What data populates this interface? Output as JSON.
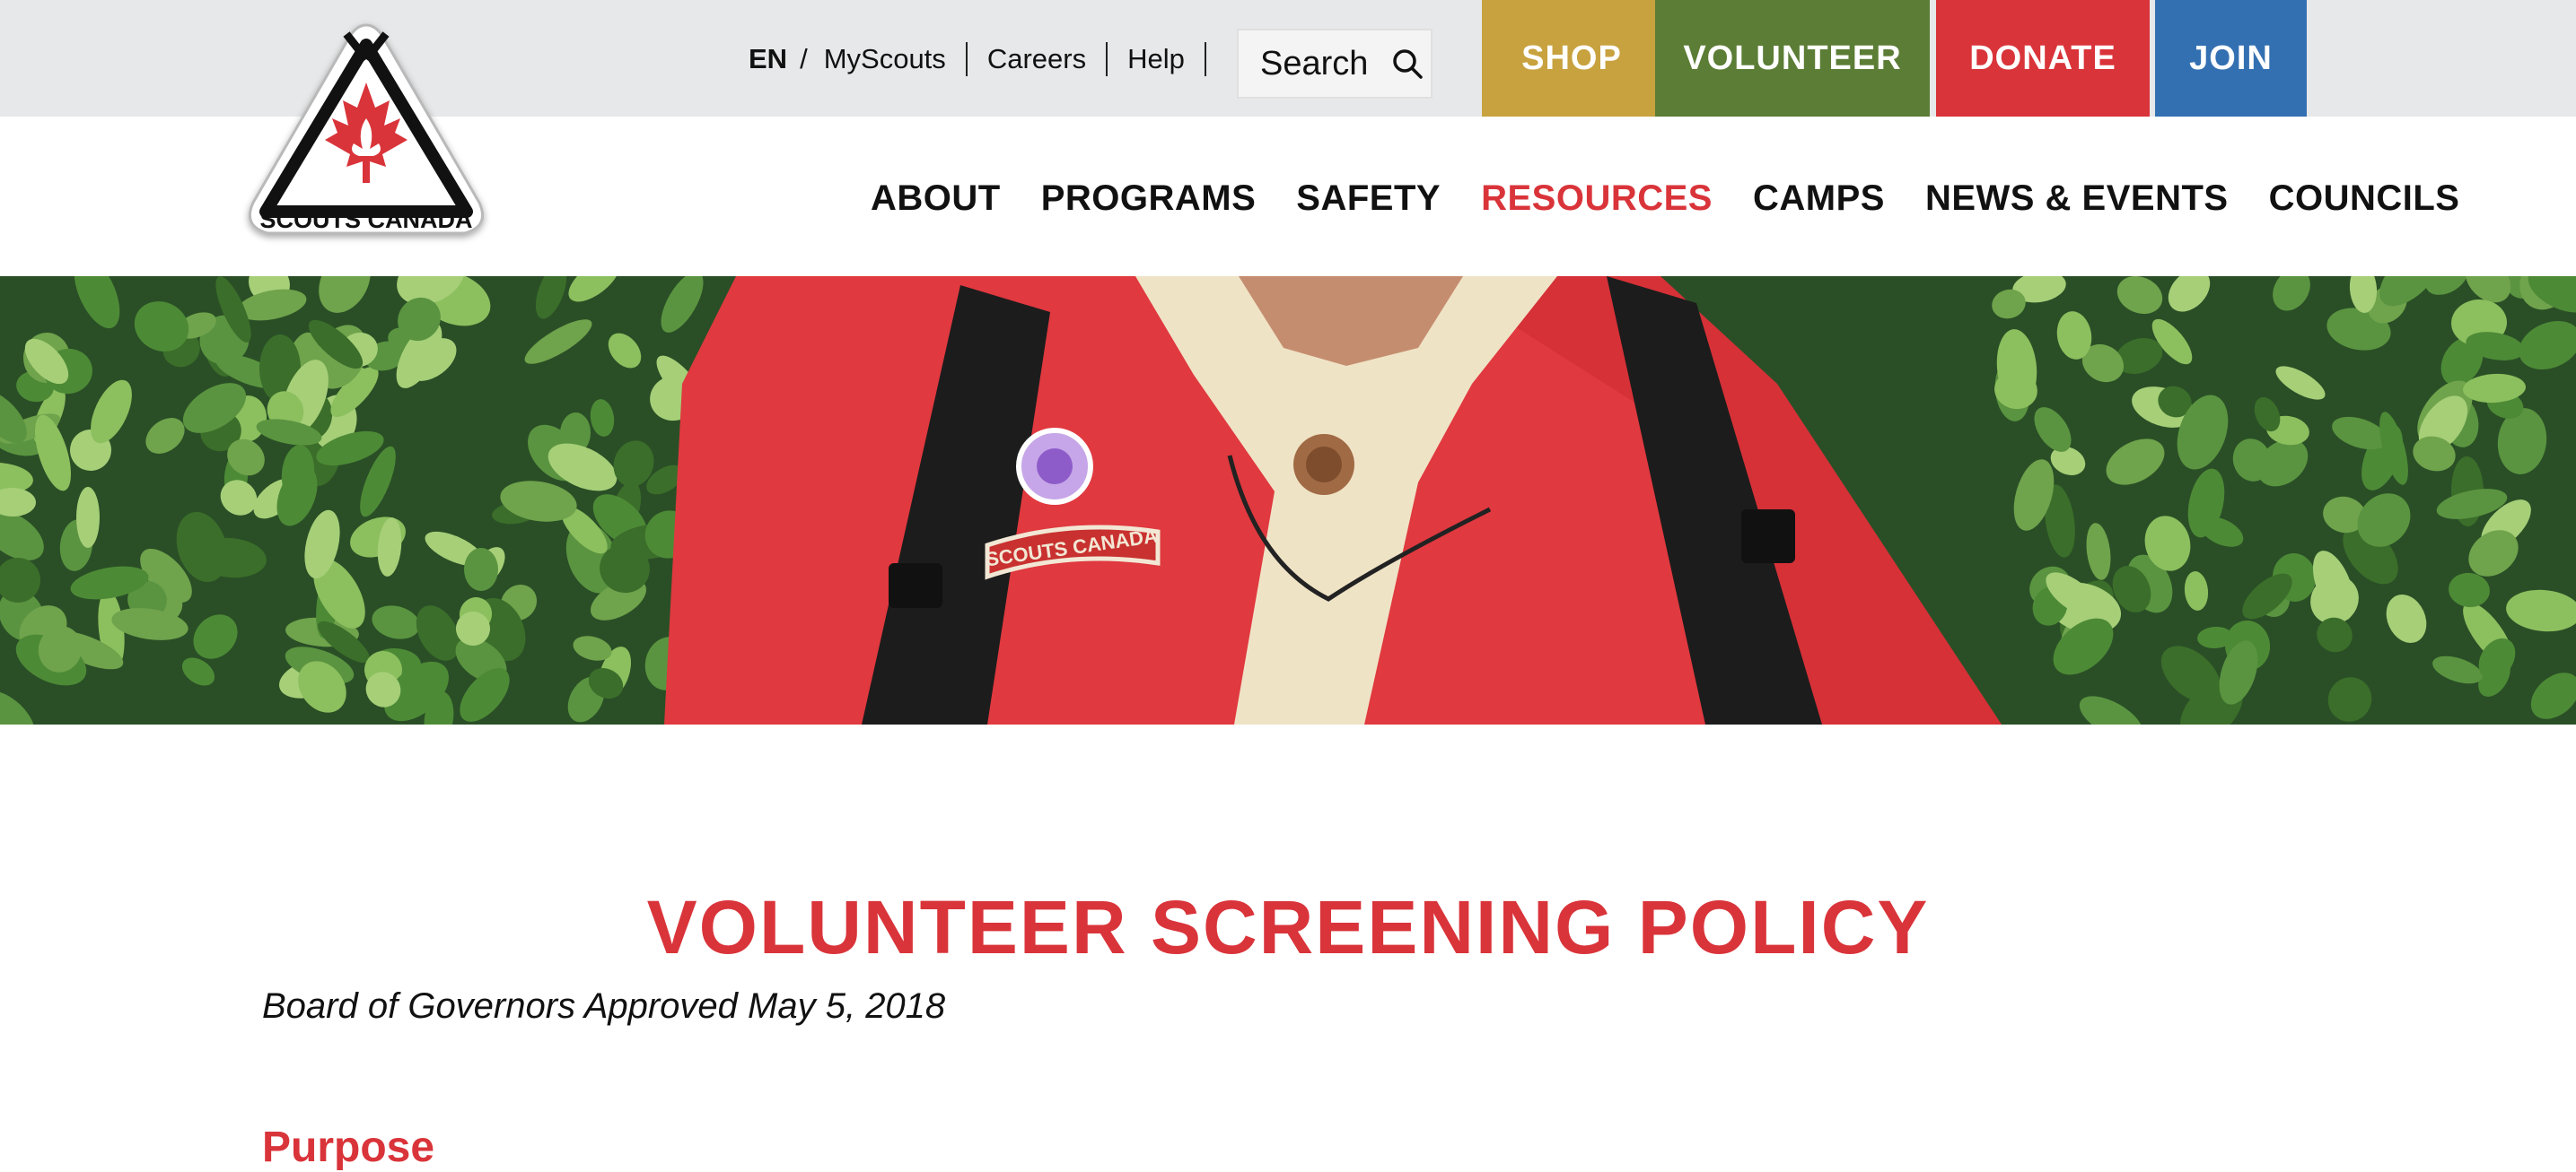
{
  "logo": {
    "text": "SCOUTS CANADA"
  },
  "utility": {
    "language": "EN",
    "slash": "/",
    "links": [
      "MyScouts",
      "Careers",
      "Help"
    ],
    "search_label": "Search"
  },
  "cta": {
    "shop": "SHOP",
    "volunteer": "VOLUNTEER",
    "donate": "DONATE",
    "join": "JOIN"
  },
  "nav": {
    "items": [
      "ABOUT",
      "PROGRAMS",
      "SAFETY",
      "RESOURCES",
      "CAMPS",
      "NEWS & EVENTS",
      "COUNCILS"
    ],
    "active": "RESOURCES"
  },
  "hero": {
    "badge_text": "SCOUTS CANADA"
  },
  "content": {
    "title": "VOLUNTEER SCREENING POLICY",
    "approved": "Board of Governors Approved May 5, 2018",
    "section_heading": "Purpose"
  },
  "colors": {
    "red": "#d9343a",
    "shop": "#c8a23f",
    "volunteer": "#5c7d35",
    "donate": "#d9343a",
    "join": "#3370b2",
    "utility_bg": "#e7e8e9"
  },
  "icons": {
    "search": "magnifier-icon",
    "logo": "scouts-canada-logo"
  }
}
